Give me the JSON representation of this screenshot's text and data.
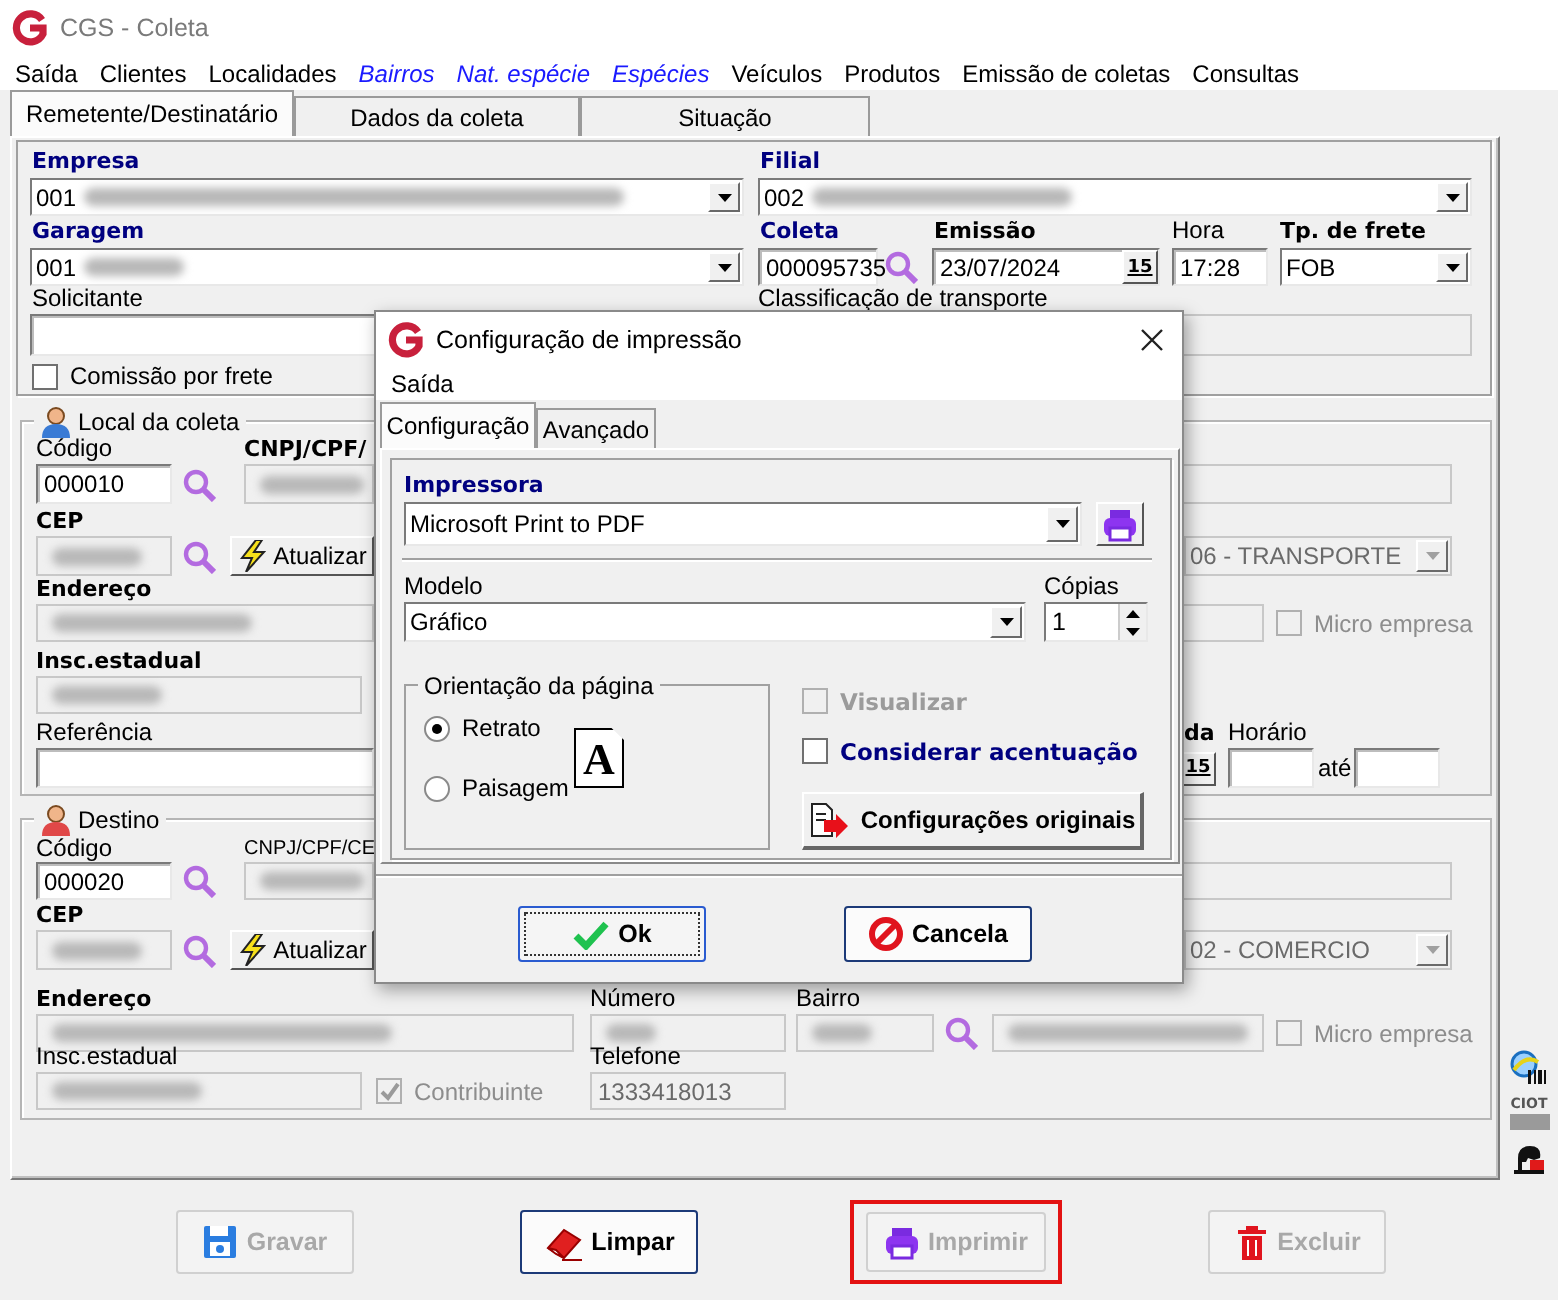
{
  "window": {
    "title": "CGS - Coleta"
  },
  "menu": [
    {
      "label": "Saída",
      "highlighted": false
    },
    {
      "label": "Clientes",
      "highlighted": false
    },
    {
      "label": "Localidades",
      "highlighted": false
    },
    {
      "label": "Bairros",
      "highlighted": true
    },
    {
      "label": "Nat. espécie",
      "highlighted": true
    },
    {
      "label": "Espécies",
      "highlighted": true
    },
    {
      "label": "Veículos",
      "highlighted": false
    },
    {
      "label": "Produtos",
      "highlighted": false
    },
    {
      "label": "Emissão de coletas",
      "highlighted": false
    },
    {
      "label": "Consultas",
      "highlighted": false
    }
  ],
  "tabs": [
    {
      "label": "Remetente/Destinatário",
      "selected": true
    },
    {
      "label": "Dados da coleta",
      "selected": false
    },
    {
      "label": "Situação",
      "selected": false
    }
  ],
  "header": {
    "empresa": {
      "label": "Empresa",
      "value": "001",
      "blurred": true
    },
    "filial": {
      "label": "Filial",
      "value": "002",
      "blurred": true
    },
    "garagem": {
      "label": "Garagem",
      "value": "001",
      "blurred": true
    },
    "coleta": {
      "label": "Coleta",
      "value": "000095735"
    },
    "emissao": {
      "label": "Emissão",
      "value": "23/07/2024",
      "calendar": "15"
    },
    "hora": {
      "label": "Hora",
      "value": "17:28"
    },
    "frete": {
      "label": "Tp. de frete",
      "value": "FOB"
    },
    "solicitante": {
      "label": "Solicitante"
    },
    "classificacao": {
      "label": "Classificação de transporte",
      "disabled": true
    },
    "comissao": {
      "label": "Comissão por frete",
      "checked": false,
      "disabled": false
    }
  },
  "pickup": {
    "title": "Local da coleta",
    "codigo": {
      "label": "Código",
      "value": "000010"
    },
    "cnpj": {
      "label": "CNPJ/CPF/",
      "blurred": true
    },
    "cep": {
      "label": "CEP",
      "blurred": true
    },
    "atualizar": "Atualizar",
    "endereco": {
      "label": "Endereço",
      "blurred": true
    },
    "insc": {
      "label": "Insc.estadual",
      "blurred": true
    },
    "referencia": {
      "label": "Referência"
    },
    "classe": {
      "value": "06 - TRANSPORTE"
    },
    "micro": {
      "label": "Micro empresa",
      "checked": false,
      "disabled": true
    },
    "data": {
      "label": "da",
      "calendar": "15"
    },
    "horario": {
      "label": "Horário",
      "until": "até"
    }
  },
  "destination": {
    "title": "Destino",
    "codigo": {
      "label": "Código",
      "value": "000020"
    },
    "cnpj": {
      "label": "CNPJ/CPF/CE",
      "blurred": true
    },
    "cep": {
      "label": "CEP",
      "blurred": true
    },
    "atualizar": "Atualizar",
    "endereco": {
      "label": "Endereço",
      "blurred": true
    },
    "numero": {
      "label": "Número",
      "blurred": true
    },
    "bairro": {
      "label": "Bairro",
      "blurred": true
    },
    "bairro_nome": {
      "blurred": true
    },
    "insc": {
      "label": "Insc.estadual",
      "blurred": true
    },
    "contribuinte": {
      "label": "Contribuinte",
      "checked": true,
      "disabled": true
    },
    "telefone": {
      "label": "Telefone",
      "value": "1333418013"
    },
    "classe": {
      "value": "02 - COMERCIO"
    },
    "micro": {
      "label": "Micro empresa",
      "checked": false,
      "disabled": true
    }
  },
  "side_tools": {
    "ciot_label": "CIOT"
  },
  "actions": [
    {
      "label": "Gravar",
      "kind": "save",
      "disabled": true,
      "highlighted": false
    },
    {
      "label": "Limpar",
      "kind": "erase",
      "disabled": false,
      "highlighted": false
    },
    {
      "label": "Imprimir",
      "kind": "print",
      "disabled": true,
      "highlighted": true
    },
    {
      "label": "Excluir",
      "kind": "delete",
      "disabled": true,
      "highlighted": false
    }
  ],
  "dialog": {
    "title": "Configuração de impressão",
    "menu": [
      "Saída"
    ],
    "tabs": [
      {
        "label": "Configuração",
        "selected": true
      },
      {
        "label": "Avançado",
        "selected": false
      }
    ],
    "impressora": {
      "label": "Impressora",
      "value": "Microsoft Print to PDF"
    },
    "modelo": {
      "label": "Modelo",
      "value": "Gráfico"
    },
    "copias": {
      "label": "Cópias",
      "value": "1"
    },
    "orientacao": {
      "title": "Orientação da página",
      "glyph": "A",
      "options": [
        {
          "label": "Retrato",
          "selected": true
        },
        {
          "label": "Paisagem",
          "selected": false
        }
      ]
    },
    "visualizar": {
      "label": "Visualizar",
      "checked": false,
      "disabled": true
    },
    "considerar": {
      "label": "Considerar acentuação",
      "checked": false,
      "disabled": false
    },
    "reset_button": "Configurações originais",
    "ok": "Ok",
    "cancel": "Cancela"
  }
}
